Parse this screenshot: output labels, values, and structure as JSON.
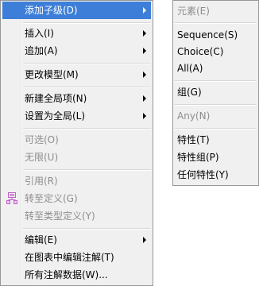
{
  "main_menu": {
    "items": [
      {
        "label": "添加子级(D)",
        "has_submenu": true,
        "highlighted": true,
        "enabled": true
      },
      {
        "label": "插入(I)",
        "has_submenu": true,
        "enabled": true
      },
      {
        "label": "追加(A)",
        "has_submenu": true,
        "enabled": true
      },
      {
        "label": "更改模型(M)",
        "has_submenu": true,
        "enabled": true
      },
      {
        "label": "新建全局项(N)",
        "has_submenu": true,
        "enabled": true
      },
      {
        "label": "设置为全局(L)",
        "has_submenu": true,
        "enabled": true
      },
      {
        "label": "可选(O)",
        "enabled": false
      },
      {
        "label": "无限(U)",
        "enabled": false
      },
      {
        "label": "引用(R)",
        "enabled": false
      },
      {
        "label": "转至定义(G)",
        "enabled": false,
        "icon": "go-to-definition-icon"
      },
      {
        "label": "转至类型定义(Y)",
        "enabled": false
      },
      {
        "label": "编辑(E)",
        "has_submenu": true,
        "enabled": true
      },
      {
        "label": "在图表中编辑注解(T)",
        "enabled": true
      },
      {
        "label": "所有注解数据(W)...",
        "enabled": true
      }
    ]
  },
  "sub_menu": {
    "items": [
      {
        "label": "元素(E)",
        "enabled": false
      },
      {
        "label": "Sequence(S)",
        "enabled": true
      },
      {
        "label": "Choice(C)",
        "enabled": true
      },
      {
        "label": "All(A)",
        "enabled": true
      },
      {
        "label": "组(G)",
        "enabled": true
      },
      {
        "label": "Any(N)",
        "enabled": false
      },
      {
        "label": "特性(T)",
        "enabled": true
      },
      {
        "label": "特性组(P)",
        "enabled": true
      },
      {
        "label": "任何特性(Y)",
        "enabled": true
      }
    ]
  },
  "colors": {
    "menu_bg": "#f0f0f0",
    "highlight": "#3d7fd8",
    "disabled_text": "#8d8d8d",
    "border": "#979797",
    "icon_accent": "#c062c8"
  }
}
